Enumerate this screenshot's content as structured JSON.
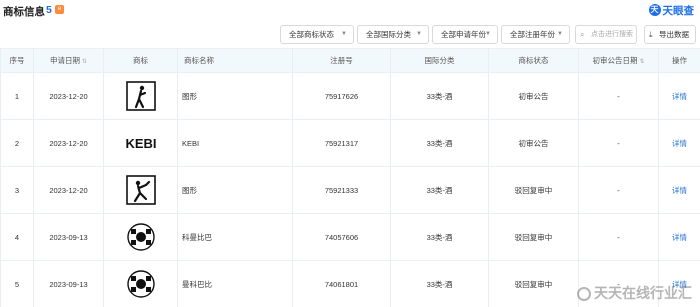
{
  "header": {
    "title": "商标信息",
    "count": "5",
    "badge": "e",
    "brand_logo": "天",
    "brand_name": "天眼查"
  },
  "filters": [
    {
      "label": "全部商标状态"
    },
    {
      "label": "全部国际分类"
    },
    {
      "label": "全部申请年份"
    },
    {
      "label": "全部注册年份"
    }
  ],
  "search": {
    "placeholder": "点击进行搜索",
    "icon": "search-icon"
  },
  "export": {
    "label": "导出数据",
    "icon": "download-icon"
  },
  "table": {
    "headers": {
      "index": "序号",
      "date": "申请日期",
      "logo": "商标",
      "name": "商标名称",
      "reg": "注册号",
      "class": "国际分类",
      "status": "商标状态",
      "pub": "初审公告日期",
      "action": "操作"
    },
    "rows": [
      {
        "index": "1",
        "date": "2023-12-20",
        "logo_text": "",
        "name": "图形",
        "reg": "75917626",
        "class": "33类-酒",
        "status": "初审公告",
        "pub": "-",
        "action": "详情"
      },
      {
        "index": "2",
        "date": "2023-12-20",
        "logo_text": "KEBI",
        "name": "KEBI",
        "reg": "75921317",
        "class": "33类-酒",
        "status": "初审公告",
        "pub": "-",
        "action": "详情"
      },
      {
        "index": "3",
        "date": "2023-12-20",
        "logo_text": "",
        "name": "图形",
        "reg": "75921333",
        "class": "33类-酒",
        "status": "驳回复审中",
        "pub": "-",
        "action": "详情"
      },
      {
        "index": "4",
        "date": "2023-09-13",
        "logo_text": "",
        "name": "科曼比巴",
        "reg": "74057606",
        "class": "33类-酒",
        "status": "驳回复审中",
        "pub": "-",
        "action": "详情"
      },
      {
        "index": "5",
        "date": "2023-09-13",
        "logo_text": "",
        "name": "曼科巴比",
        "reg": "74061801",
        "class": "33类-酒",
        "status": "驳回复审中",
        "pub": "-",
        "action": "详情"
      }
    ]
  },
  "watermark": "天天在线行业汇"
}
